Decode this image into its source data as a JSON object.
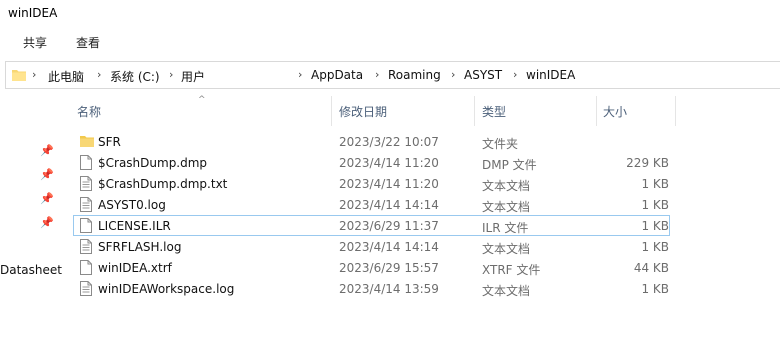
{
  "window": {
    "title": "winIDEA"
  },
  "ribbon": {
    "tabs": [
      "共享",
      "查看"
    ]
  },
  "address": {
    "crumbs": [
      "此电脑",
      "系统 (C:)",
      "用户",
      "AppData",
      "Roaming",
      "ASYST",
      "winIDEA"
    ]
  },
  "nav": {
    "label": "Datasheet"
  },
  "columns": {
    "name": "名称",
    "date": "修改日期",
    "type": "类型",
    "size": "大小"
  },
  "files": [
    {
      "name": "SFR",
      "date": "2023/3/22 10:07",
      "type": "文件夹",
      "size": "",
      "icon": "folder-icon"
    },
    {
      "name": "$CrashDump.dmp",
      "date": "2023/4/14 11:20",
      "type": "DMP 文件",
      "size": "229 KB",
      "icon": "file-icon"
    },
    {
      "name": "$CrashDump.dmp.txt",
      "date": "2023/4/14 11:20",
      "type": "文本文档",
      "size": "1 KB",
      "icon": "text-file-icon"
    },
    {
      "name": "ASYST0.log",
      "date": "2023/4/14 14:14",
      "type": "文本文档",
      "size": "1 KB",
      "icon": "text-file-icon"
    },
    {
      "name": "LICENSE.ILR",
      "date": "2023/6/29 11:37",
      "type": "ILR 文件",
      "size": "1 KB",
      "icon": "file-icon",
      "selected": true
    },
    {
      "name": "SFRFLASH.log",
      "date": "2023/4/14 14:14",
      "type": "文本文档",
      "size": "1 KB",
      "icon": "text-file-icon"
    },
    {
      "name": "winIDEA.xtrf",
      "date": "2023/6/29 15:57",
      "type": "XTRF 文件",
      "size": "44 KB",
      "icon": "file-icon"
    },
    {
      "name": "winIDEAWorkspace.log",
      "date": "2023/4/14 13:59",
      "type": "文本文档",
      "size": "1 KB",
      "icon": "text-file-icon"
    }
  ],
  "colors": {
    "folder": "#f8d775",
    "selection_border": "#99c9ef",
    "header_text": "#4c607a"
  }
}
